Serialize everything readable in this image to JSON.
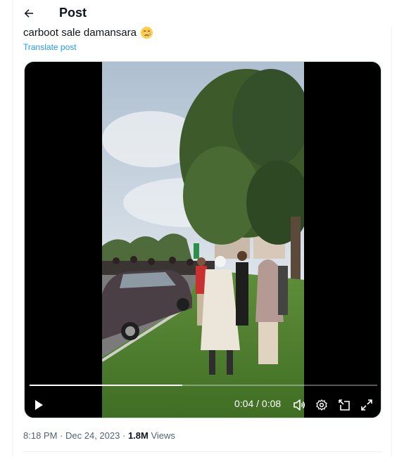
{
  "header": {
    "title": "Post",
    "back_icon": "arrow-left-icon"
  },
  "post": {
    "text": "carboot sale damansara",
    "emoji": "crying-face-emoji",
    "translate_label": "Translate post"
  },
  "video": {
    "progress_fraction": 0.44,
    "time_display": "0:04 / 0:08",
    "controls": [
      "play-icon",
      "volume-icon",
      "settings-icon",
      "picture-in-picture-icon",
      "fullscreen-icon"
    ]
  },
  "meta": {
    "time": "8:18 PM",
    "separator": "·",
    "date": "Dec 24, 2023",
    "views_count": "1.8M",
    "views_label": "Views"
  },
  "colors": {
    "link": "#1d9bf0",
    "text": "#0f1419",
    "muted": "#536471"
  }
}
